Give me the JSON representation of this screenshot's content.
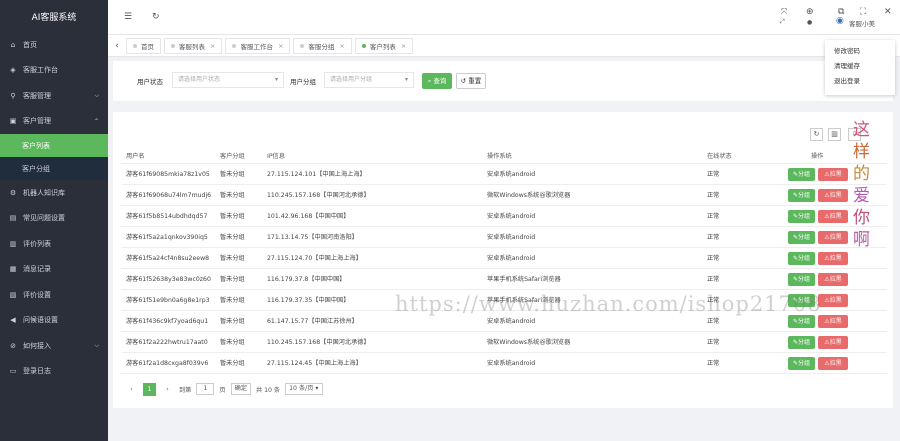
{
  "app": {
    "logo": "AI客服系统"
  },
  "sidebar": {
    "items": [
      {
        "label": "首页",
        "icon": "home-icon"
      },
      {
        "label": "客服工作台",
        "icon": "workbench-icon"
      },
      {
        "label": "客服管理",
        "icon": "user-icon"
      },
      {
        "label": "客户管理",
        "icon": "briefcase-icon"
      },
      {
        "label": "机器人知识库",
        "icon": "robot-icon"
      },
      {
        "label": "常见问题设置",
        "icon": "question-icon"
      },
      {
        "label": "评价列表",
        "icon": "rating-icon"
      },
      {
        "label": "消息记录",
        "icon": "message-icon"
      },
      {
        "label": "评价设置",
        "icon": "settings-icon"
      },
      {
        "label": "问候语设置",
        "icon": "greeting-icon"
      },
      {
        "label": "如何接入",
        "icon": "connect-icon"
      },
      {
        "label": "登录日志",
        "icon": "log-icon"
      }
    ],
    "sub": [
      "客户列表",
      "客户分组"
    ]
  },
  "topbar": {
    "user_name": "客服小美"
  },
  "tabs": [
    "首页",
    "客服列表",
    "客服工作台",
    "客服分组",
    "客户列表"
  ],
  "dropdown": [
    "修改密码",
    "清理缓存",
    "退出登录"
  ],
  "search": {
    "status_label": "用户状态",
    "status_placeholder": "请选择用户状态",
    "group_label": "用户分组",
    "group_placeholder": "请选择用户分组",
    "search_btn": "查询",
    "reset_btn": "重置"
  },
  "table": {
    "headers": [
      "用户名",
      "客户分组",
      "IP信息",
      "操作系统",
      "在线状态",
      "操作"
    ],
    "btn_group": "分组",
    "btn_black": "拉黑",
    "rows": [
      [
        "游客61f69085mkia78z1v05",
        "暂未分组",
        "27.115.124.101【中国上海上海】",
        "安卓系统android",
        "正常"
      ],
      [
        "游客61f69068u74lm7mudj6",
        "暂未分组",
        "110.245.157.168【中国河北承德】",
        "微软Windows系统谷歌浏览器",
        "正常"
      ],
      [
        "游客61f5b8514ubdhdqd57",
        "暂未分组",
        "101.42.96.168【中国中国】",
        "安卓系统android",
        "正常"
      ],
      [
        "游客61f5a2a1qnkov390iq5",
        "暂未分组",
        "171.13.14.75【中国河南洛阳】",
        "安卓系统android",
        "正常"
      ],
      [
        "游客61f5a24cf4n8su2eew8",
        "暂未分组",
        "27.115.124.70【中国上海上海】",
        "安卓系统android",
        "正常"
      ],
      [
        "游客61f52638y3e83wc0z60",
        "暂未分组",
        "116.179.37.8【中国中国】",
        "苹果手机系统Safari浏览器",
        "正常"
      ],
      [
        "游客61f51e9bn0a6g8e1rp3",
        "暂未分组",
        "116.179.37.35【中国中国】",
        "苹果手机系统Safari浏览器",
        "正常"
      ],
      [
        "游客61f436c9kf7yoad6qu1",
        "暂未分组",
        "61.147.15.77【中国江苏徐州】",
        "安卓系统android",
        "正常"
      ],
      [
        "游客61f2a222hwtru17aat0",
        "暂未分组",
        "110.245.157.168【中国河北承德】",
        "微软Windows系统谷歌浏览器",
        "正常"
      ],
      [
        "游客61f2a1d8cxga8f039v6",
        "暂未分组",
        "27.115.124.45【中国上海上海】",
        "安卓系统android",
        "正常"
      ]
    ]
  },
  "pager": {
    "current": "1",
    "goto": "到第",
    "page_input": "1",
    "page_unit": "页",
    "confirm": "确定",
    "total": "共 10 条",
    "size": "10 条/页"
  },
  "watermark": {
    "url": "https://www.huzhan.com/ishop21708",
    "vertical": [
      "这",
      "样",
      "的",
      "爱",
      "你",
      "啊"
    ]
  }
}
